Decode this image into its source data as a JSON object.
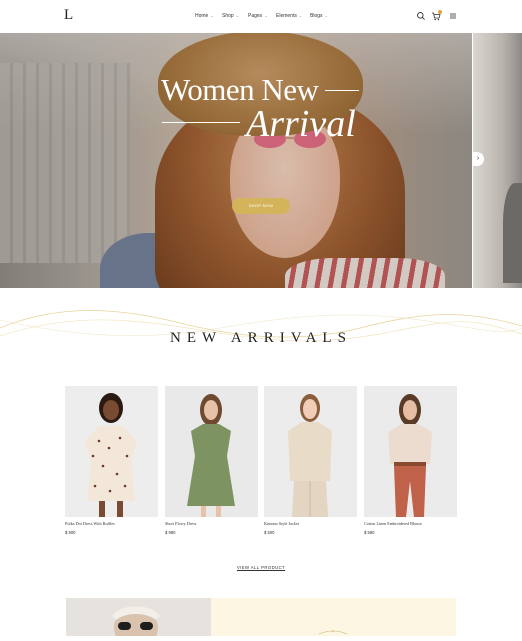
{
  "header": {
    "logo": "L",
    "nav": [
      {
        "label": "Home"
      },
      {
        "label": "Shop"
      },
      {
        "label": "Pages"
      },
      {
        "label": "Elements"
      },
      {
        "label": "Blogs"
      }
    ],
    "icons": [
      "search-icon",
      "cart-icon",
      "menu-icon"
    ],
    "badge_color": "#e3a13c"
  },
  "hero": {
    "title_line1": "Women New",
    "title_line2": "Arrival",
    "button": "SHOP NOW",
    "button_color": "#d4b45a"
  },
  "new_arrivals": {
    "title": "NEW ARRIVALS",
    "products": [
      {
        "name": "Polka Dot Dress With Ruffles",
        "price": "$ 900"
      },
      {
        "name": "Short Flowy Dress",
        "price": "$ 980"
      },
      {
        "name": "Kimono Style Jacket",
        "price": "$ 500"
      },
      {
        "name": "Cotton Linen Embroidered Blouse",
        "price": "$ 590"
      }
    ],
    "view_all": "VIEW ALL PRODUCT"
  }
}
